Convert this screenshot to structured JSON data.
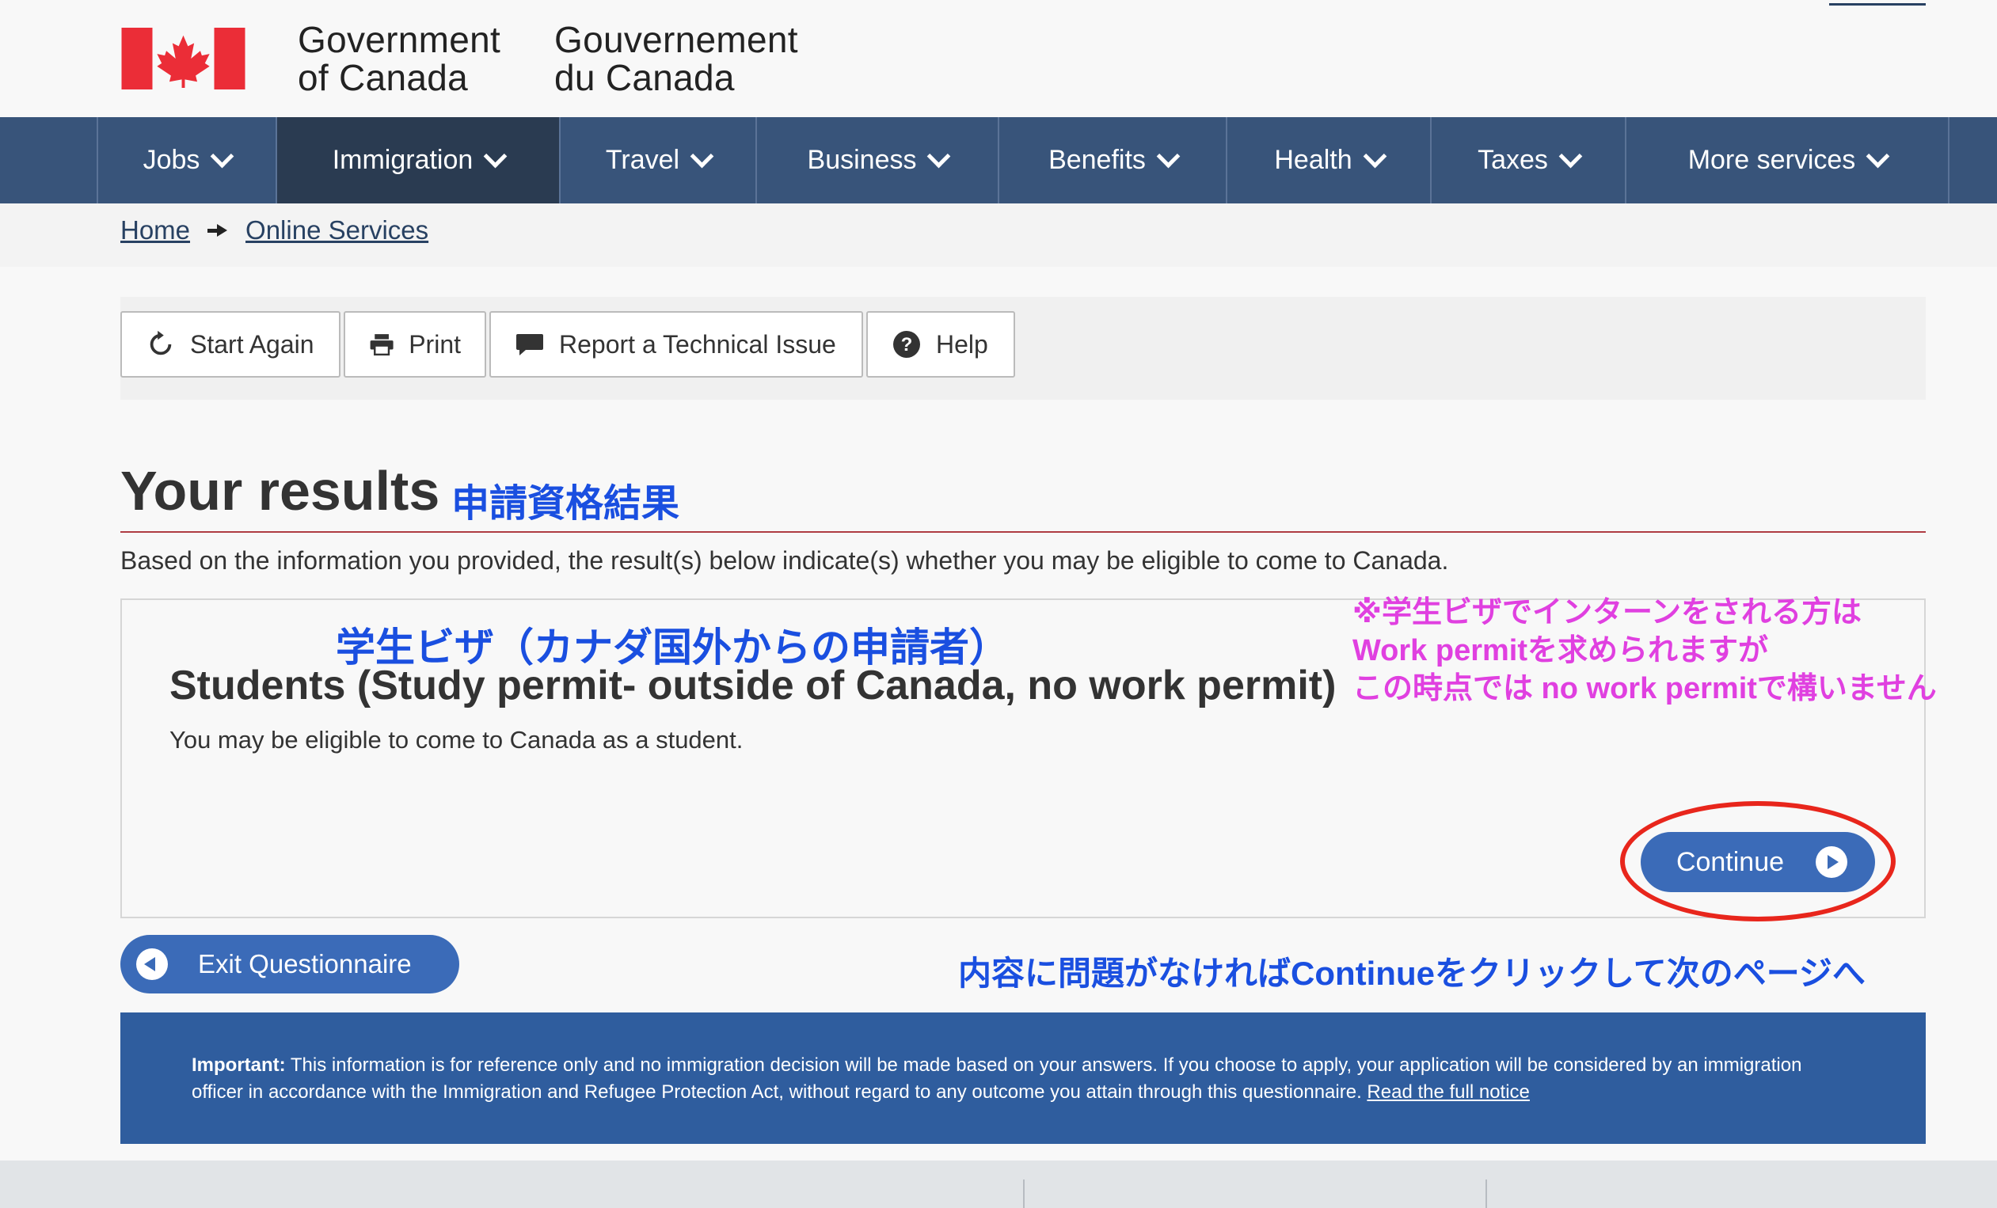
{
  "header": {
    "sig_en_1": "Government",
    "sig_en_2": "of Canada",
    "sig_fr_1": "Gouvernement",
    "sig_fr_2": "du Canada",
    "flag_icon": "canada-flag-icon",
    "colors": {
      "flag_red": "#eb2d37",
      "nav": "#38547a",
      "nav_active": "#2a3b51"
    }
  },
  "nav": {
    "items": [
      {
        "label": "Jobs"
      },
      {
        "label": "Immigration"
      },
      {
        "label": "Travel"
      },
      {
        "label": "Business"
      },
      {
        "label": "Benefits"
      },
      {
        "label": "Health"
      },
      {
        "label": "Taxes"
      },
      {
        "label": "More services"
      }
    ],
    "active": "Immigration"
  },
  "breadcrumb": {
    "home": "Home",
    "online_services": "Online Services"
  },
  "toolbar": {
    "start_again": "Start Again",
    "print": "Print",
    "report": "Report a Technical Issue",
    "help": "Help"
  },
  "results": {
    "title": "Your results",
    "jp_title": "申請資格結果",
    "intro": "Based on the information you provided, the result(s) below indicate(s) whether you may be eligible to come to Canada.",
    "jp_student": "学生ビザ（カナダ国外からの申請者）",
    "student_title": "Students (Study permit- outside of Canada, no work permit)",
    "student_desc": "You may be eligible to come to Canada as a student.",
    "continue": "Continue",
    "exit": "Exit Questionnaire",
    "jp_continue": "内容に問題がなければContinueをクリックして次のページへ"
  },
  "note": {
    "line1": "※学生ビザでインターンをされる方は",
    "line2": "Work permitを求められますが",
    "line3": "この時点では no work permitで構いません"
  },
  "important": {
    "label": "Important:",
    "text": " This information is for reference only and no immigration decision will be made based on your answers. If you choose to apply, your application will be considered by an immigration officer in accordance with the Immigration and Refugee Protection Act, without regard to any outcome you attain through this questionnaire. ",
    "link": "Read the full notice"
  }
}
